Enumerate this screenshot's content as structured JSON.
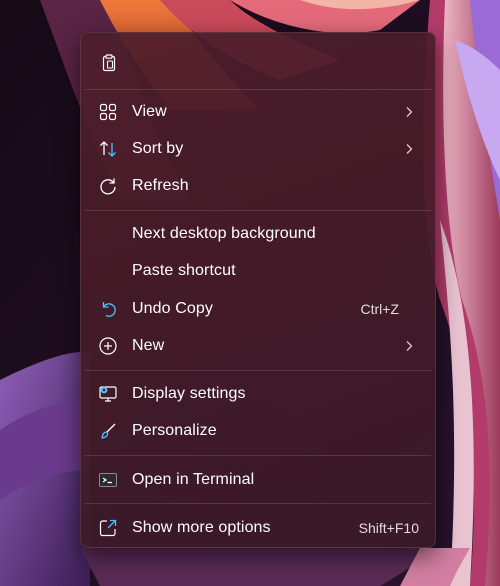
{
  "colors": {
    "menu_bg": "#4a1c2b",
    "text": "#ffffff",
    "shortcut_text": "#e4d9dd",
    "accent_icon": "#4cc2ff"
  },
  "quick_actions": [
    {
      "icon": "clipboard-icon"
    }
  ],
  "menu": {
    "view_label": "View",
    "sort_by_label": "Sort by",
    "refresh_label": "Refresh",
    "next_bg_label": "Next desktop background",
    "paste_shortcut_label": "Paste shortcut",
    "undo_copy_label": "Undo Copy",
    "undo_copy_shortcut": "Ctrl+Z",
    "new_label": "New",
    "display_settings_label": "Display settings",
    "personalize_label": "Personalize",
    "open_terminal_label": "Open in Terminal",
    "show_more_label": "Show more options",
    "show_more_shortcut": "Shift+F10"
  },
  "icons": {
    "view": "grid-icon",
    "sort_by": "sort-arrows-icon",
    "refresh": "refresh-icon",
    "undo": "undo-icon",
    "new": "plus-circle-icon",
    "display_settings": "display-settings-icon",
    "personalize": "brush-icon",
    "terminal": "terminal-icon",
    "show_more": "share-icon",
    "submenu": "chevron-right-icon"
  }
}
